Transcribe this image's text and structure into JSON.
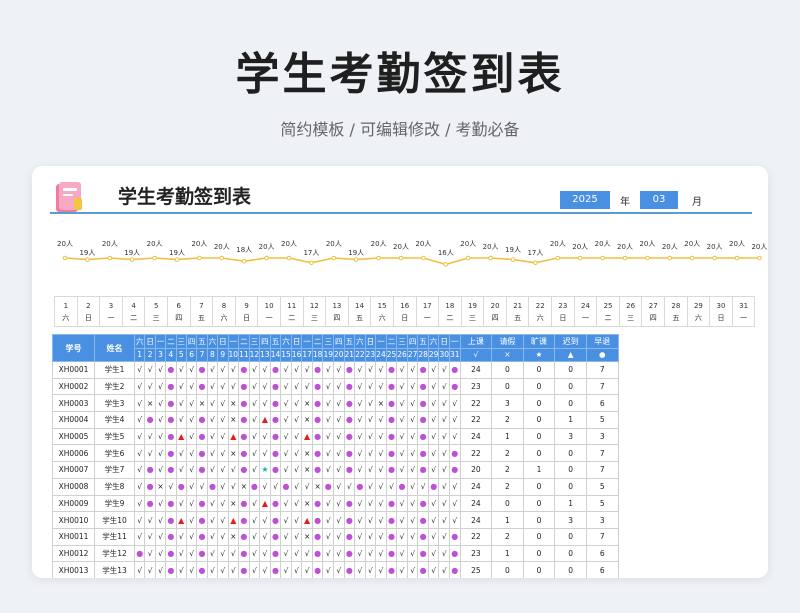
{
  "header": {
    "title": "学生考勤签到表",
    "subtitle": "简约模板 /  可编辑修改  / 考勤必备"
  },
  "sheet": {
    "title": "学生考勤签到表",
    "year": "2025",
    "year_label": "年",
    "month": "03",
    "month_label": "月"
  },
  "trend": {
    "values": [
      20,
      19,
      20,
      19,
      20,
      19,
      20,
      20,
      18,
      20,
      20,
      17,
      20,
      19,
      20,
      20,
      20,
      16,
      20,
      20,
      19,
      17,
      20,
      20,
      20,
      20,
      20,
      20,
      20,
      20,
      20,
      20
    ],
    "label_suffix": "人",
    "line_color": "#f0c040"
  },
  "days": {
    "numbers": [
      "1",
      "2",
      "3",
      "4",
      "5",
      "6",
      "7",
      "8",
      "9",
      "10",
      "11",
      "12",
      "13",
      "14",
      "15",
      "16",
      "17",
      "18",
      "19",
      "20",
      "21",
      "22",
      "23",
      "24",
      "25",
      "26",
      "27",
      "28",
      "29",
      "30",
      "31"
    ],
    "weekdays": [
      "六",
      "日",
      "一",
      "二",
      "三",
      "四",
      "五",
      "六",
      "日",
      "一",
      "二",
      "三",
      "四",
      "五",
      "六",
      "日",
      "一",
      "二",
      "三",
      "四",
      "五",
      "六",
      "日",
      "一",
      "二",
      "三",
      "四",
      "五",
      "六",
      "日",
      "一"
    ]
  },
  "table": {
    "col_id": "学号",
    "col_name": "姓名",
    "stats": [
      {
        "label": "上课",
        "symbol": "√"
      },
      {
        "label": "请假",
        "symbol": "×"
      },
      {
        "label": "旷课",
        "symbol": "★"
      },
      {
        "label": "迟到",
        "symbol": "▲"
      },
      {
        "label": "早退",
        "symbol": "●"
      }
    ],
    "rows": [
      {
        "id": "XH0001",
        "name": "学生1",
        "marks": "√√√●√√●√√√●√√●√√√●√√●√√√●√√●√√●",
        "stats": [
          "24",
          "0",
          "0",
          "0",
          "7"
        ]
      },
      {
        "id": "XH0002",
        "name": "学生2",
        "marks": "√√√●√√●√√√●√√●√√√●√√●√√√●√√●√√●",
        "stats": [
          "23",
          "0",
          "0",
          "0",
          "7"
        ]
      },
      {
        "id": "XH0003",
        "name": "学生3",
        "marks": "√×√●√√×√√×●√√●√√×●√√●√√×●√√●√√√",
        "stats": [
          "22",
          "3",
          "0",
          "0",
          "6"
        ]
      },
      {
        "id": "XH0004",
        "name": "学生4",
        "marks": "√●√●√√●√√×●√▲●√√×●√√●√√√●√√●√√√",
        "stats": [
          "22",
          "2",
          "0",
          "1",
          "5"
        ]
      },
      {
        "id": "XH0005",
        "name": "学生5",
        "marks": "√√√●▲√●√√▲●√√●√√▲●√√●√√√●√√●√√√",
        "stats": [
          "24",
          "1",
          "0",
          "3",
          "3"
        ]
      },
      {
        "id": "XH0006",
        "name": "学生6",
        "marks": "√√√●√√●√√×●√√●√√×●√√●√√√●√√●√√●",
        "stats": [
          "22",
          "2",
          "0",
          "0",
          "7"
        ]
      },
      {
        "id": "XH0007",
        "name": "学生7",
        "marks": "√●√●√√●√√√●√★●√√×●√√●√√√●√√●√√●",
        "stats": [
          "20",
          "2",
          "1",
          "0",
          "7"
        ]
      },
      {
        "id": "XH0008",
        "name": "学生8",
        "marks": "√●×√●√√●√√×●√√●√√×●√√●√√√●√√●√√",
        "stats": [
          "24",
          "2",
          "0",
          "0",
          "5"
        ]
      },
      {
        "id": "XH0009",
        "name": "学生9",
        "marks": "√●√●√√●√√×●√▲●√√×●√√●√√√●√√●√√√",
        "stats": [
          "24",
          "0",
          "0",
          "1",
          "5"
        ]
      },
      {
        "id": "XH0010",
        "name": "学生10",
        "marks": "√√√●▲√●√√▲●√√●√√▲●√√●√√√●√√●√√√",
        "stats": [
          "24",
          "1",
          "0",
          "3",
          "3"
        ]
      },
      {
        "id": "XH0011",
        "name": "学生11",
        "marks": "√√√●√√●√√×●√√●√√×●√√●√√√●√√●√√●",
        "stats": [
          "22",
          "2",
          "0",
          "0",
          "7"
        ]
      },
      {
        "id": "XH0012",
        "name": "学生12",
        "marks": "●√√●√√●√√√●√√●√√√●√√●√√√●√√●√√●",
        "stats": [
          "23",
          "1",
          "0",
          "0",
          "6"
        ]
      },
      {
        "id": "XH0013",
        "name": "学生13",
        "marks": "√√√●√√●√√√●√√●√√√●√√●√√√●√√●√√●",
        "stats": [
          "25",
          "0",
          "0",
          "0",
          "6"
        ]
      }
    ]
  }
}
